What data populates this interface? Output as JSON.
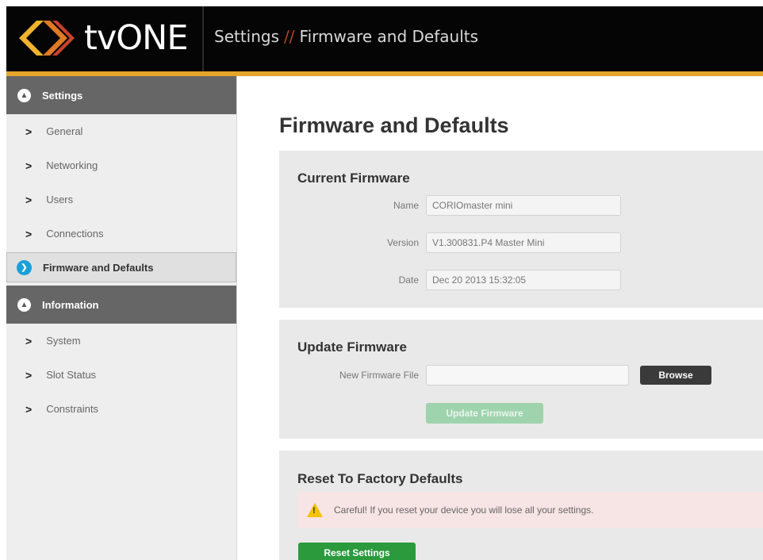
{
  "header": {
    "brand": "tvONE",
    "crumb_1": "Settings",
    "crumb_sep": "//",
    "crumb_2": "Firmware and Defaults",
    "accent": "#e3a52c"
  },
  "sidebar": {
    "sections": [
      {
        "label": "Settings",
        "items": [
          "General",
          "Networking",
          "Users",
          "Connections",
          "Firmware and Defaults"
        ],
        "active": "Firmware and Defaults"
      },
      {
        "label": "Information",
        "items": [
          "System",
          "Slot Status",
          "Constraints"
        ]
      }
    ]
  },
  "main": {
    "title": "Firmware and Defaults",
    "current_firmware": {
      "title": "Current Firmware",
      "name_label": "Name",
      "name_value": "CORIOmaster mini",
      "version_label": "Version",
      "version_value": "V1.300831.P4 Master Mini",
      "date_label": "Date",
      "date_value": "Dec 20 2013 15:32:05"
    },
    "update_firmware": {
      "title": "Update Firmware",
      "file_label": "New Firmware File",
      "file_value": "",
      "browse_label": "Browse",
      "update_label": "Update Firmware"
    },
    "reset": {
      "title": "Reset To Factory Defaults",
      "warning": "Careful! If you reset your device you will lose all your settings.",
      "button_label": "Reset Settings"
    }
  },
  "icons": {
    "logo": "chevrons-logo-icon",
    "section_toggle": "collapse-circle-icon",
    "active_item": "arrow-circle-icon",
    "item": "chevron-right-icon",
    "warning": "warning-icon"
  }
}
